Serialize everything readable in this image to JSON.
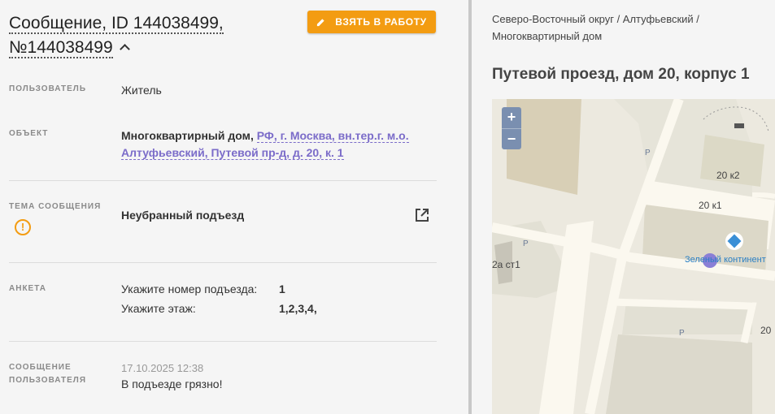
{
  "message": {
    "title_line1": "Сообщение, ID 144038499,",
    "title_line2": "№144038499",
    "take_button": "ВЗЯТЬ В РАБОТУ"
  },
  "fields": {
    "user_label": "ПОЛЬЗОВАТЕЛЬ",
    "user_value": "Житель",
    "object_label": "ОБЪЕКТ",
    "object_type": "Многоквартирный дом,",
    "object_address_line1": "РФ, г. Москва, вн.тер.г. м.о.",
    "object_address_line2": "Алтуфьевский, Путевой пр-д, д. 20, к. 1",
    "topic_label": "ТЕМА СООБЩЕНИЯ",
    "topic_value": "Неубранный подъезд",
    "survey_label": "АНКЕТА",
    "survey": [
      {
        "question": "Укажите номер подъезда:",
        "answer": "1"
      },
      {
        "question": "Укажите этаж:",
        "answer": "1,2,3,4,"
      }
    ],
    "user_msg_label_line1": "СООБЩЕНИЕ",
    "user_msg_label_line2": "ПОЛЬЗОВАТЕЛЯ",
    "user_msg_date": "17.10.2025 12:38",
    "user_msg_text": "В подъезде грязно!"
  },
  "location": {
    "breadcrumb_line1": "Северо-Восточный округ / Алтуфьевский /",
    "breadcrumb_line2": "Многоквартирный дом",
    "address": "Путевой проезд, дом 20, корпус 1"
  },
  "map": {
    "zoom_in": "+",
    "zoom_out": "−",
    "labels": {
      "building_20k2": "20 к2",
      "building_20k1": "20 к1",
      "building_2a": "2а ст1",
      "building_20": "20",
      "poi": "Зеленый континент",
      "parking": "P"
    }
  },
  "colors": {
    "accent": "#f39c12",
    "link": "#7b6cc9",
    "marker": "#8a7fd6",
    "zoom": "#7a8fb0"
  }
}
